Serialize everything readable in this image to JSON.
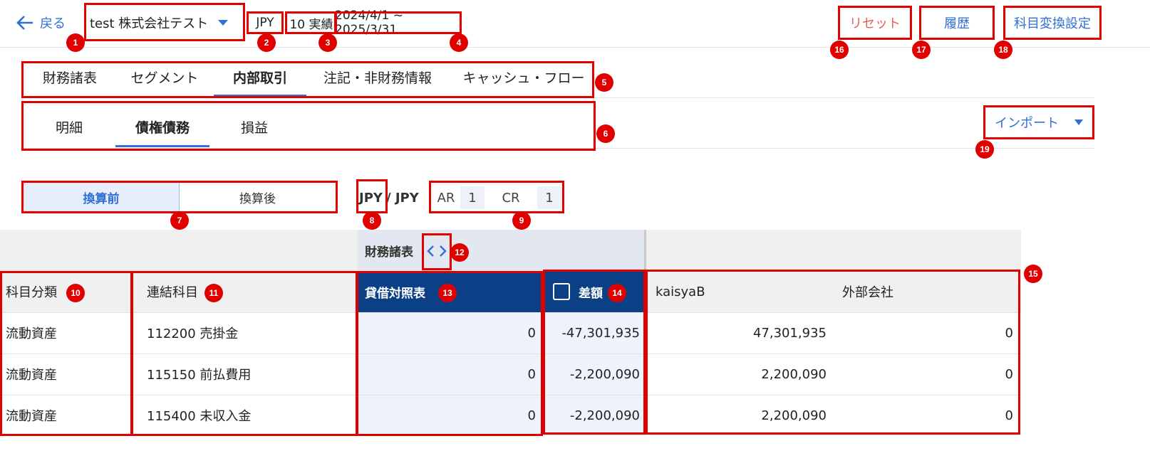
{
  "header": {
    "back_label": "戻る",
    "company": "test 株式会社テスト",
    "currency": "JPY",
    "actual_label": "10 実績",
    "period": "2024/4/1 ~ 2025/3/31",
    "reset_label": "リセット",
    "history_label": "履歴",
    "mapping_label": "科目変換設定"
  },
  "main_tabs": [
    {
      "label": "財務諸表",
      "active": false
    },
    {
      "label": "セグメント",
      "active": false
    },
    {
      "label": "内部取引",
      "active": true
    },
    {
      "label": "注記・非財務情報",
      "active": false
    },
    {
      "label": "キャッシュ・フロー",
      "active": false
    }
  ],
  "sub_tabs": [
    {
      "label": "明細",
      "active": false
    },
    {
      "label": "債権債務",
      "active": true
    },
    {
      "label": "損益",
      "active": false
    }
  ],
  "import_label": "インポート",
  "conversion": {
    "before": "換算前",
    "after": "換算後",
    "selected": "before"
  },
  "currency_pair": {
    "from": "JPY",
    "sep": "/ JPY"
  },
  "rates": {
    "ar_label": "AR",
    "ar_value": "1",
    "cr_label": "CR",
    "cr_value": "1"
  },
  "table": {
    "group_label": "財務諸表",
    "columns": {
      "category": "科目分類",
      "account": "連結科目",
      "bs": "貸借対照表",
      "diff": "差額",
      "company_b": "kaisyaB",
      "external": "外部会社"
    },
    "rows": [
      {
        "category": "流動資産",
        "account": "112200 売掛金",
        "bs": "0",
        "diff": "-47,301,935",
        "company_b": "47,301,935",
        "external": "0"
      },
      {
        "category": "流動資産",
        "account": "115150 前払費用",
        "bs": "0",
        "diff": "-2,200,090",
        "company_b": "2,200,090",
        "external": "0"
      },
      {
        "category": "流動資産",
        "account": "115400 未収入金",
        "bs": "0",
        "diff": "-2,200,090",
        "company_b": "2,200,090",
        "external": "0"
      }
    ]
  },
  "badges": [
    "1",
    "2",
    "3",
    "4",
    "5",
    "6",
    "7",
    "8",
    "9",
    "10",
    "11",
    "12",
    "13",
    "14",
    "15",
    "16",
    "17",
    "18",
    "19"
  ],
  "colors": {
    "accent": "#2f6fd6",
    "header_dark": "#0b3f86",
    "annotation": "#e00000"
  }
}
